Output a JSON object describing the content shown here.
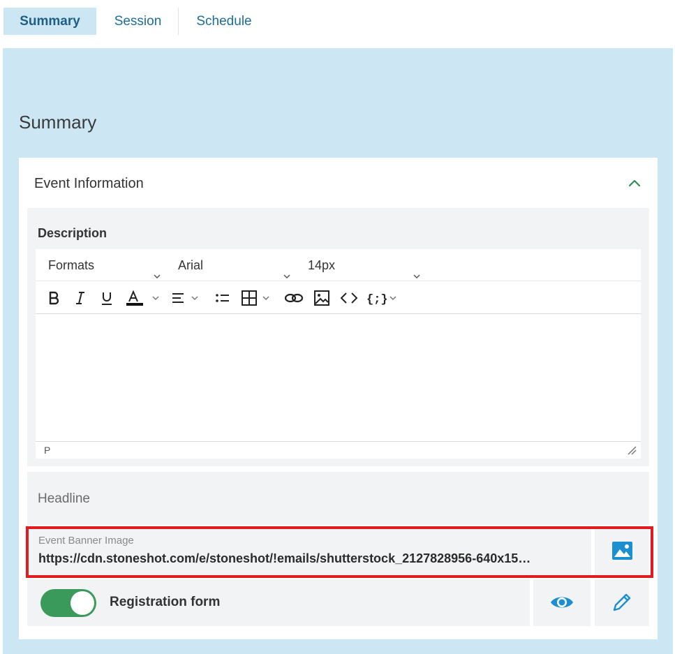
{
  "tabs": [
    {
      "label": "Summary",
      "active": true
    },
    {
      "label": "Session",
      "active": false
    },
    {
      "label": "Schedule",
      "active": false
    }
  ],
  "page_title": "Summary",
  "event_info": {
    "title": "Event Information",
    "collapse_icon": "chevron-up-icon",
    "description": {
      "label": "Description",
      "formats_select": "Formats",
      "font_select": "Arial",
      "size_select": "14px",
      "toolbar_icons": [
        "bold-icon",
        "italic-icon",
        "underline-icon",
        "text-color-icon",
        "align-icon",
        "bullet-list-icon",
        "table-icon",
        "link-icon",
        "image-icon",
        "code-icon",
        "merge-tag-icon"
      ],
      "content": "",
      "status_path": "P"
    },
    "headline": {
      "placeholder": "Headline"
    },
    "banner": {
      "label": "Event Banner Image",
      "value": "https://cdn.stoneshot.com/e/stoneshot/!emails/shutterstock_2127828956-640x15…",
      "button_icon": "image-icon"
    },
    "registration": {
      "label": "Registration form",
      "enabled": true,
      "preview_icon": "eye-icon",
      "edit_icon": "pencil-icon"
    }
  },
  "colors": {
    "accent": "#1b8fd0",
    "toggle_on": "#3a9a5b",
    "highlight": "#e11b22",
    "panel_bg": "#cce6f4",
    "chevron": "#2e8b57"
  }
}
